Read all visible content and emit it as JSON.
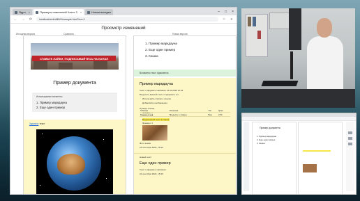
{
  "browser": {
    "tabs": [
      {
        "label": "Ядро",
        "active": false
      },
      {
        "label": "Примеры изменений Часть 2",
        "active": true
      },
      {
        "label": "Новая вкладка",
        "active": false
      }
    ],
    "url": "localhost/web/diff/v2/example.html?rev=1",
    "page_title": "Просмотр изменений",
    "sub_left": "Исходная версия",
    "sub_center": "Сравнить",
    "sub_right": "Новая версия"
  },
  "left": {
    "banner_text": "СТАВЬТЕ ЛАЙКИ, ПОДПИСЫВАЙТЕСЬ НА КАНАЛ",
    "doc_title": "Пример документа",
    "box_caption": "Используемые элементы",
    "list": [
      "1. Пример маркдауна",
      "2. Еще один пример"
    ],
    "yellow_prefix": "Удалено",
    "yellow_suffix": "текст"
  },
  "right": {
    "list": [
      "1. Пример маркдауна",
      "2. Еще один пример",
      "3. Кошка"
    ],
    "green_text": "Вставлено текст фрагмента",
    "section_title": "Пример маркдауна",
    "lines": [
      "Текст в формате markdown 12.01.2025 12:34",
      "Выделите важный текст и оформите его",
      "Используйте списки и ссылки",
      "Добавляйте изображения",
      "Пример списка:",
      "Элемент 1",
      "Элемент 2",
      "Выделенный текст в списке",
      "Элемент 4"
    ],
    "table_header": [
      "Таблица",
      "Описание",
      "Тип",
      "Цена"
    ],
    "table_rows": [
      [
        "Молоко отзыв",
        "Продукты и товары",
        "Вид",
        "2.50"
      ]
    ],
    "caption": "Фото кошки",
    "date1": "24 сентября 2024, 15:40",
    "section2_label": "Новый текст",
    "section2_title": "Еще один пример",
    "section2_line": "Текст в формате markdown",
    "date2": "24 сентября 2024, 15:40"
  },
  "mini": {
    "title": "Пример документа",
    "items": [
      "1. Пример маркдауна",
      "2. Еще один пример",
      "3. Кошка"
    ]
  },
  "colors": {
    "yellow": "#fdf7c7",
    "green": "#dbf3dc",
    "banner_red": "#c0242b",
    "link": "#2a6fdb"
  }
}
